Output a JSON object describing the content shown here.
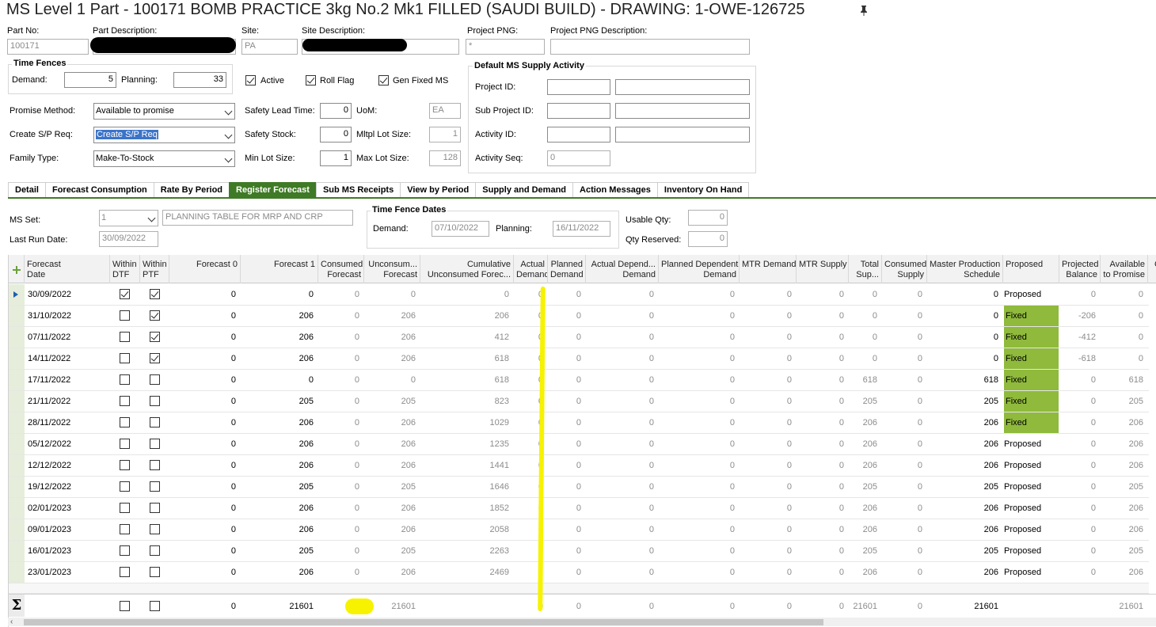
{
  "title": "MS Level 1 Part - 100171 BOMB PRACTICE 3kg No.2 Mk1 FILLED (SAUDI BUILD) - DRAWING: 1-OWE-126725",
  "header": {
    "part_no_label": "Part No:",
    "part_no": "100171",
    "part_desc_label": "Part Description:",
    "site_label": "Site:",
    "site": "PA",
    "site_desc_label": "Site Description:",
    "project_png_label": "Project PNG:",
    "project_png": "*",
    "project_png_desc_label": "Project PNG Description:"
  },
  "time_fences": {
    "title": "Time Fences",
    "demand_label": "Demand:",
    "demand": "5",
    "planning_label": "Planning:",
    "planning": "33"
  },
  "flags": {
    "active": "Active",
    "roll_flag": "Roll Flag",
    "gen_fixed_ms": "Gen Fixed MS"
  },
  "params": {
    "promise_method_label": "Promise Method:",
    "promise_method": "Available to promise",
    "create_sp_req_label": "Create S/P Req:",
    "create_sp_req": "Create S/P Req",
    "family_type_label": "Family Type:",
    "family_type": "Make-To-Stock",
    "safety_lead_time_label": "Safety Lead Time:",
    "safety_lead_time": "0",
    "safety_stock_label": "Safety Stock:",
    "safety_stock": "0",
    "min_lot_size_label": "Min Lot Size:",
    "min_lot_size": "1",
    "uom_label": "UoM:",
    "uom": "EA",
    "mltpl_lot_size_label": "Mltpl Lot Size:",
    "mltpl_lot_size": "1",
    "max_lot_size_label": "Max Lot Size:",
    "max_lot_size": "128"
  },
  "supply_activity": {
    "title": "Default MS Supply Activity",
    "project_id_label": "Project ID:",
    "sub_project_id_label": "Sub Project ID:",
    "activity_id_label": "Activity ID:",
    "activity_seq_label": "Activity Seq:",
    "activity_seq": "0"
  },
  "tabs": [
    "Detail",
    "Forecast Consumption",
    "Rate By Period",
    "Register Forecast",
    "Sub MS Receipts",
    "View by Period",
    "Supply and Demand",
    "Action Messages",
    "Inventory On Hand"
  ],
  "active_tab": "Register Forecast",
  "ms": {
    "ms_set_label": "MS Set:",
    "ms_set": "1",
    "ms_set_desc": "PLANNING TABLE FOR MRP AND CRP",
    "last_run_label": "Last Run Date:",
    "last_run": "30/09/2022",
    "tfd_title": "Time Fence Dates",
    "tfd_demand_label": "Demand:",
    "tfd_demand": "07/10/2022",
    "tfd_planning_label": "Planning:",
    "tfd_planning": "16/11/2022",
    "usable_qty_label": "Usable Qty:",
    "usable_qty": "0",
    "qty_reserved_label": "Qty Reserved:",
    "qty_reserved": "0"
  },
  "columns": [
    {
      "l1": "Forecast",
      "l2": "Date"
    },
    {
      "l1": "Within",
      "l2": "DTF"
    },
    {
      "l1": "Within",
      "l2": "PTF"
    },
    {
      "l1": "Forecast 0",
      "l2": ""
    },
    {
      "l1": "Forecast 1",
      "l2": ""
    },
    {
      "l1": "Consumed",
      "l2": "Forecast"
    },
    {
      "l1": "Unconsum...",
      "l2": "Forecast"
    },
    {
      "l1": "Cumulative",
      "l2": "Unconsumed Forec..."
    },
    {
      "l1": "Actual",
      "l2": "Demand"
    },
    {
      "l1": "Planned",
      "l2": "Demand"
    },
    {
      "l1": "Actual Depend...",
      "l2": "Demand"
    },
    {
      "l1": "Planned Dependent",
      "l2": "Demand"
    },
    {
      "l1": "MTR Demand",
      "l2": ""
    },
    {
      "l1": "MTR Supply",
      "l2": ""
    },
    {
      "l1": "Total",
      "l2": "Sup..."
    },
    {
      "l1": "Consumed",
      "l2": "Supply"
    },
    {
      "l1": "Master Production",
      "l2": "Schedule"
    },
    {
      "l1": "Proposed",
      "l2": ""
    },
    {
      "l1": "Projected",
      "l2": "Balance"
    },
    {
      "l1": "Available",
      "l2": "to Promise"
    },
    {
      "l1": "C",
      "l2": ""
    }
  ],
  "rows": [
    {
      "date": "30/09/2022",
      "dtf": true,
      "ptf": true,
      "f0": "0",
      "f1": "0",
      "cf": "0",
      "uf": "0",
      "cuf": "0",
      "ad": "0",
      "pd": "0",
      "adp": "0",
      "pdd": "0",
      "mtrd": "0",
      "mtrs": "0",
      "ts": "0",
      "cs": "0",
      "mps": "0",
      "prop": "Proposed",
      "fixed": false,
      "pb": "0",
      "atp": "0"
    },
    {
      "date": "31/10/2022",
      "dtf": false,
      "ptf": true,
      "f0": "0",
      "f1": "206",
      "cf": "0",
      "uf": "206",
      "cuf": "206",
      "ad": "0",
      "pd": "0",
      "adp": "0",
      "pdd": "0",
      "mtrd": "0",
      "mtrs": "0",
      "ts": "0",
      "cs": "0",
      "mps": "0",
      "prop": "Fixed",
      "fixed": true,
      "pb": "-206",
      "atp": "0"
    },
    {
      "date": "07/11/2022",
      "dtf": false,
      "ptf": true,
      "f0": "0",
      "f1": "206",
      "cf": "0",
      "uf": "206",
      "cuf": "412",
      "ad": "0",
      "pd": "0",
      "adp": "0",
      "pdd": "0",
      "mtrd": "0",
      "mtrs": "0",
      "ts": "0",
      "cs": "0",
      "mps": "0",
      "prop": "Fixed",
      "fixed": true,
      "pb": "-412",
      "atp": "0"
    },
    {
      "date": "14/11/2022",
      "dtf": false,
      "ptf": true,
      "f0": "0",
      "f1": "206",
      "cf": "0",
      "uf": "206",
      "cuf": "618",
      "ad": "0",
      "pd": "0",
      "adp": "0",
      "pdd": "0",
      "mtrd": "0",
      "mtrs": "0",
      "ts": "0",
      "cs": "0",
      "mps": "0",
      "prop": "Fixed",
      "fixed": true,
      "pb": "-618",
      "atp": "0"
    },
    {
      "date": "17/11/2022",
      "dtf": false,
      "ptf": false,
      "f0": "0",
      "f1": "0",
      "cf": "0",
      "uf": "0",
      "cuf": "618",
      "ad": "0",
      "pd": "0",
      "adp": "0",
      "pdd": "0",
      "mtrd": "0",
      "mtrs": "0",
      "ts": "618",
      "cs": "0",
      "mps": "618",
      "prop": "Fixed",
      "fixed": true,
      "pb": "0",
      "atp": "618"
    },
    {
      "date": "21/11/2022",
      "dtf": false,
      "ptf": false,
      "f0": "0",
      "f1": "205",
      "cf": "0",
      "uf": "205",
      "cuf": "823",
      "ad": "0",
      "pd": "0",
      "adp": "0",
      "pdd": "0",
      "mtrd": "0",
      "mtrs": "0",
      "ts": "205",
      "cs": "0",
      "mps": "205",
      "prop": "Fixed",
      "fixed": true,
      "pb": "0",
      "atp": "205"
    },
    {
      "date": "28/11/2022",
      "dtf": false,
      "ptf": false,
      "f0": "0",
      "f1": "206",
      "cf": "0",
      "uf": "206",
      "cuf": "1029",
      "ad": "0",
      "pd": "0",
      "adp": "0",
      "pdd": "0",
      "mtrd": "0",
      "mtrs": "0",
      "ts": "206",
      "cs": "0",
      "mps": "206",
      "prop": "Fixed",
      "fixed": true,
      "pb": "0",
      "atp": "206"
    },
    {
      "date": "05/12/2022",
      "dtf": false,
      "ptf": false,
      "f0": "0",
      "f1": "206",
      "cf": "0",
      "uf": "206",
      "cuf": "1235",
      "ad": "0",
      "pd": "0",
      "adp": "0",
      "pdd": "0",
      "mtrd": "0",
      "mtrs": "0",
      "ts": "206",
      "cs": "0",
      "mps": "206",
      "prop": "Proposed",
      "fixed": false,
      "pb": "0",
      "atp": "206"
    },
    {
      "date": "12/12/2022",
      "dtf": false,
      "ptf": false,
      "f0": "0",
      "f1": "206",
      "cf": "0",
      "uf": "206",
      "cuf": "1441",
      "ad": "0",
      "pd": "0",
      "adp": "0",
      "pdd": "0",
      "mtrd": "0",
      "mtrs": "0",
      "ts": "206",
      "cs": "0",
      "mps": "206",
      "prop": "Proposed",
      "fixed": false,
      "pb": "0",
      "atp": "206"
    },
    {
      "date": "19/12/2022",
      "dtf": false,
      "ptf": false,
      "f0": "0",
      "f1": "205",
      "cf": "0",
      "uf": "205",
      "cuf": "1646",
      "ad": "0",
      "pd": "0",
      "adp": "0",
      "pdd": "0",
      "mtrd": "0",
      "mtrs": "0",
      "ts": "205",
      "cs": "0",
      "mps": "205",
      "prop": "Proposed",
      "fixed": false,
      "pb": "0",
      "atp": "205"
    },
    {
      "date": "02/01/2023",
      "dtf": false,
      "ptf": false,
      "f0": "0",
      "f1": "206",
      "cf": "0",
      "uf": "206",
      "cuf": "1852",
      "ad": "0",
      "pd": "0",
      "adp": "0",
      "pdd": "0",
      "mtrd": "0",
      "mtrs": "0",
      "ts": "206",
      "cs": "0",
      "mps": "206",
      "prop": "Proposed",
      "fixed": false,
      "pb": "0",
      "atp": "206"
    },
    {
      "date": "09/01/2023",
      "dtf": false,
      "ptf": false,
      "f0": "0",
      "f1": "206",
      "cf": "0",
      "uf": "206",
      "cuf": "2058",
      "ad": "0",
      "pd": "0",
      "adp": "0",
      "pdd": "0",
      "mtrd": "0",
      "mtrs": "0",
      "ts": "206",
      "cs": "0",
      "mps": "206",
      "prop": "Proposed",
      "fixed": false,
      "pb": "0",
      "atp": "206"
    },
    {
      "date": "16/01/2023",
      "dtf": false,
      "ptf": false,
      "f0": "0",
      "f1": "205",
      "cf": "0",
      "uf": "205",
      "cuf": "2263",
      "ad": "0",
      "pd": "0",
      "adp": "0",
      "pdd": "0",
      "mtrd": "0",
      "mtrs": "0",
      "ts": "205",
      "cs": "0",
      "mps": "205",
      "prop": "Proposed",
      "fixed": false,
      "pb": "0",
      "atp": "205"
    },
    {
      "date": "23/01/2023",
      "dtf": false,
      "ptf": false,
      "f0": "0",
      "f1": "206",
      "cf": "0",
      "uf": "206",
      "cuf": "2469",
      "ad": "0",
      "pd": "0",
      "adp": "0",
      "pdd": "0",
      "mtrd": "0",
      "mtrs": "0",
      "ts": "206",
      "cs": "0",
      "mps": "206",
      "prop": "Proposed",
      "fixed": false,
      "pb": "0",
      "atp": "206"
    }
  ],
  "totals": {
    "sigma": "Σ",
    "f0": "0",
    "f1": "21601",
    "cf": "0",
    "uf": "21601",
    "ad": "0",
    "pd": "0",
    "adp": "0",
    "pdd": "0",
    "mtrd": "0",
    "mtrs": "0",
    "ts": "21601",
    "cs": "0",
    "mps": "21601",
    "atp": "21601"
  },
  "colors": {
    "accent_green": "#3f7a26",
    "fixed_bg": "#8fba3c",
    "highlight_yellow": "#f6f200",
    "selection_blue": "#3b73c8"
  }
}
